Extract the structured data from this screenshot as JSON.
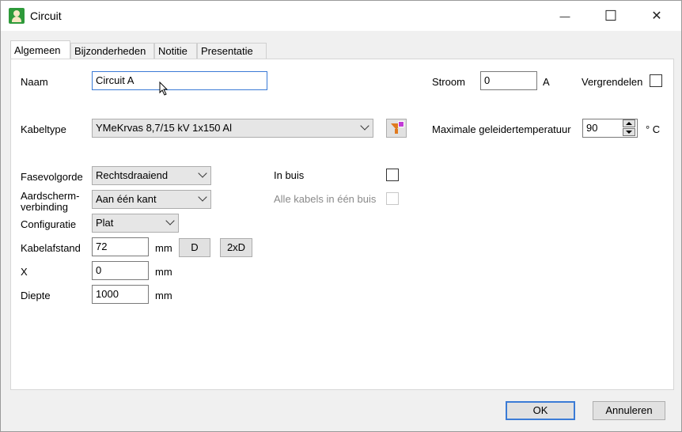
{
  "window": {
    "title": "Circuit",
    "controls": {
      "minimize": "—",
      "maximize": "☐",
      "close": "✕"
    }
  },
  "tabs": [
    {
      "label": "Algemeen",
      "active": true
    },
    {
      "label": "Bijzonderheden",
      "active": false
    },
    {
      "label": "Notitie",
      "active": false
    },
    {
      "label": "Presentatie",
      "active": false
    }
  ],
  "form": {
    "naam": {
      "label": "Naam",
      "value": "Circuit A"
    },
    "stroom": {
      "label": "Stroom",
      "value": "0",
      "unit": "A"
    },
    "vergrendelen": {
      "label": "Vergrendelen",
      "checked": false
    },
    "kabeltype": {
      "label": "Kabeltype",
      "value": "YMeKrvas 8,7/15 kV  1x150 Al"
    },
    "max_temp": {
      "label": "Maximale geleidertemperatuur",
      "value": "90",
      "unit": "° C"
    },
    "fasevolgorde": {
      "label": "Fasevolgorde",
      "value": "Rechtsdraaiend"
    },
    "aardscherm": {
      "label_line1": "Aardscherm-",
      "label_line2": "verbinding",
      "value": "Aan één kant"
    },
    "configuratie": {
      "label": "Configuratie",
      "value": "Plat"
    },
    "kabelafstand": {
      "label": "Kabelafstand",
      "value": "72",
      "unit": "mm",
      "btn_d": "D",
      "btn_2xd": "2xD"
    },
    "x": {
      "label": "X",
      "value": "0",
      "unit": "mm"
    },
    "diepte": {
      "label": "Diepte",
      "value": "1000",
      "unit": "mm"
    },
    "in_buis": {
      "label": "In buis",
      "checked": false
    },
    "alle_kabels": {
      "label": "Alle kabels in één buis",
      "checked": false,
      "disabled": true
    }
  },
  "footer": {
    "ok": "OK",
    "cancel": "Annuleren"
  },
  "colors": {
    "accent": "#3b7bd6",
    "app_icon": "#2e9a3a",
    "filter_icon": "#e07a1f"
  }
}
